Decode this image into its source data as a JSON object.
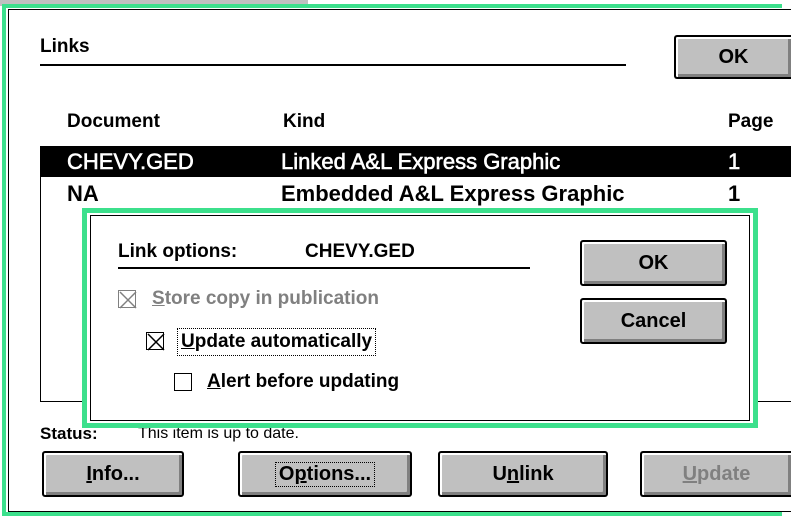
{
  "links_dialog": {
    "title_label": "Links",
    "ok_label": "OK",
    "columns": {
      "document": "Document",
      "kind": "Kind",
      "page": "Page"
    },
    "rows": [
      {
        "document": "CHEVY.GED",
        "kind": "Linked A&L Express Graphic",
        "page": "1",
        "selected": true
      },
      {
        "document": "NA",
        "kind": "Embedded A&L Express Graphic",
        "page": "1",
        "selected": false
      }
    ],
    "status_label": "Status:",
    "status_text": "This item is up to date.",
    "buttons": {
      "info": {
        "prefix": "",
        "accel": "I",
        "rest": "nfo..."
      },
      "options": {
        "prefix": "O",
        "accel": "p",
        "rest": "tions..."
      },
      "unlink": {
        "prefix": "U",
        "accel": "n",
        "rest": "link"
      },
      "update": {
        "prefix": "",
        "accel": "U",
        "rest": "pdate"
      }
    }
  },
  "link_options_dialog": {
    "label": "Link options:",
    "document": "CHEVY.GED",
    "ok_label": "OK",
    "cancel_label": "Cancel",
    "store_copy": {
      "accel": "S",
      "rest": "tore copy in publication",
      "checked": true,
      "enabled": false
    },
    "update_auto": {
      "accel": "U",
      "rest": "pdate automatically",
      "checked": true,
      "enabled": true
    },
    "alert_before": {
      "accel": "A",
      "rest": "lert before updating",
      "checked": false,
      "enabled": true
    }
  },
  "colors": {
    "frame_accent": "#3ce08c",
    "button_face": "#c0c0c0",
    "disabled_text": "#808080"
  }
}
